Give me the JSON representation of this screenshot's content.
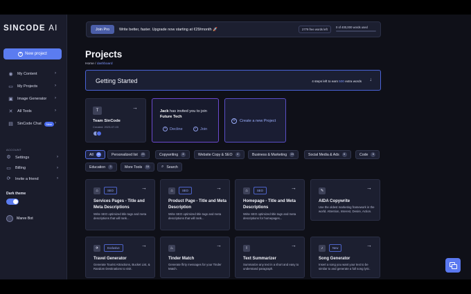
{
  "sidebar": {
    "logo_main": "SINCODE",
    "logo_ai": "AI",
    "new_project": "New project",
    "items": [
      {
        "label": "My Content",
        "icon": "content-icon"
      },
      {
        "label": "My Projects",
        "icon": "folder-icon"
      },
      {
        "label": "Image Generator",
        "icon": "image-icon"
      },
      {
        "label": "All Tools",
        "icon": "tools-icon"
      },
      {
        "label": "SinCode Chat",
        "icon": "chat-icon",
        "badge": "New"
      }
    ],
    "account_label": "ACCOUNT",
    "account_items": [
      {
        "label": "Settings",
        "icon": "gear-icon"
      },
      {
        "label": "Billing",
        "icon": "billing-icon"
      },
      {
        "label": "Invite a friend",
        "icon": "invite-icon"
      }
    ],
    "dark_theme_label": "Dark theme",
    "dark_theme_on": true,
    "user_name": "Marve Bot"
  },
  "banner": {
    "join_pro": "Join Pro",
    "text": "Write better, faster. Upgrade now starting at €29/month 🚀",
    "words_left": "2779 free words left",
    "words_used": "0 of 400,000 words used",
    "used_fraction": 0.0
  },
  "page": {
    "title": "Projects",
    "breadcrumb_home": "Home /",
    "breadcrumb_current": "dashboard"
  },
  "getting_started": {
    "title": "Getting Started",
    "steps_prefix": "4 steps left to earn",
    "steps_highlight": "500",
    "steps_suffix": "extra words"
  },
  "team_card": {
    "tile": "T",
    "name": "Team SinCode",
    "created": "Created: 2023-07-03"
  },
  "invite_card": {
    "inviter": "Jack",
    "text": "has invited you to join",
    "team": "Future Tech",
    "decline": "Decline",
    "join": "Join"
  },
  "create_card": {
    "label": "Create a new Project"
  },
  "filters": [
    {
      "label": "All",
      "count": "16"
    },
    {
      "label": "Personalized list",
      "count": "23"
    },
    {
      "label": "Copywriting",
      "count": "8"
    },
    {
      "label": "Website Copy & SEO",
      "count": "4"
    },
    {
      "label": "Business & Marketing",
      "count": "15"
    },
    {
      "label": "Social Media & Ads",
      "count": "6"
    },
    {
      "label": "Code",
      "count": "6"
    },
    {
      "label": "Education",
      "count": "3"
    },
    {
      "label": "More Tools",
      "count": "16"
    }
  ],
  "search_label": "Search",
  "tools": [
    {
      "title": "Services Pages - Title and Meta Descriptions",
      "badge": "SEO",
      "icon": "store-icon",
      "desc": "Write SEO optimized title tags and meta descriptions that will rank..."
    },
    {
      "title": "Product Page - Title and Meta Description",
      "badge": "SEO",
      "icon": "store-icon",
      "desc": "Write SEO optimized title tags and meta descriptions that will rank..."
    },
    {
      "title": "Homepage - Title and Meta Descriptions",
      "badge": "SEO",
      "icon": "home-icon",
      "desc": "Write SEO optimized title tags and meta descriptions for homepages..."
    },
    {
      "title": "AIDA Copywrite",
      "badge": "",
      "icon": "pen-icon",
      "desc": "Use the oldest marketing framework in the world. Attention, Interest, Desire, Action."
    },
    {
      "title": "Travel Generator",
      "badge": "Exclusive",
      "icon": "travel-icon",
      "desc": "Generate Tourist Attractions, Bucket List, & Random Destinations to visit."
    },
    {
      "title": "Tinder Match",
      "badge": "",
      "icon": "flame-icon",
      "desc": "Generate flirty messages for your Tinder Match."
    },
    {
      "title": "Text Summarizer",
      "badge": "",
      "icon": "text-icon",
      "desc": "Summarize any text in a short and easy to understand paragraph."
    },
    {
      "title": "Song Generator",
      "badge": "New",
      "icon": "music-icon",
      "desc": "Insert a song you want your text to be similar to and generate a full song lyric."
    }
  ],
  "colors": {
    "accent": "#5b7cf0",
    "sidebar_bg": "#1a1c2b",
    "main_bg": "#0f1018",
    "card_bg": "#1c1f30"
  }
}
